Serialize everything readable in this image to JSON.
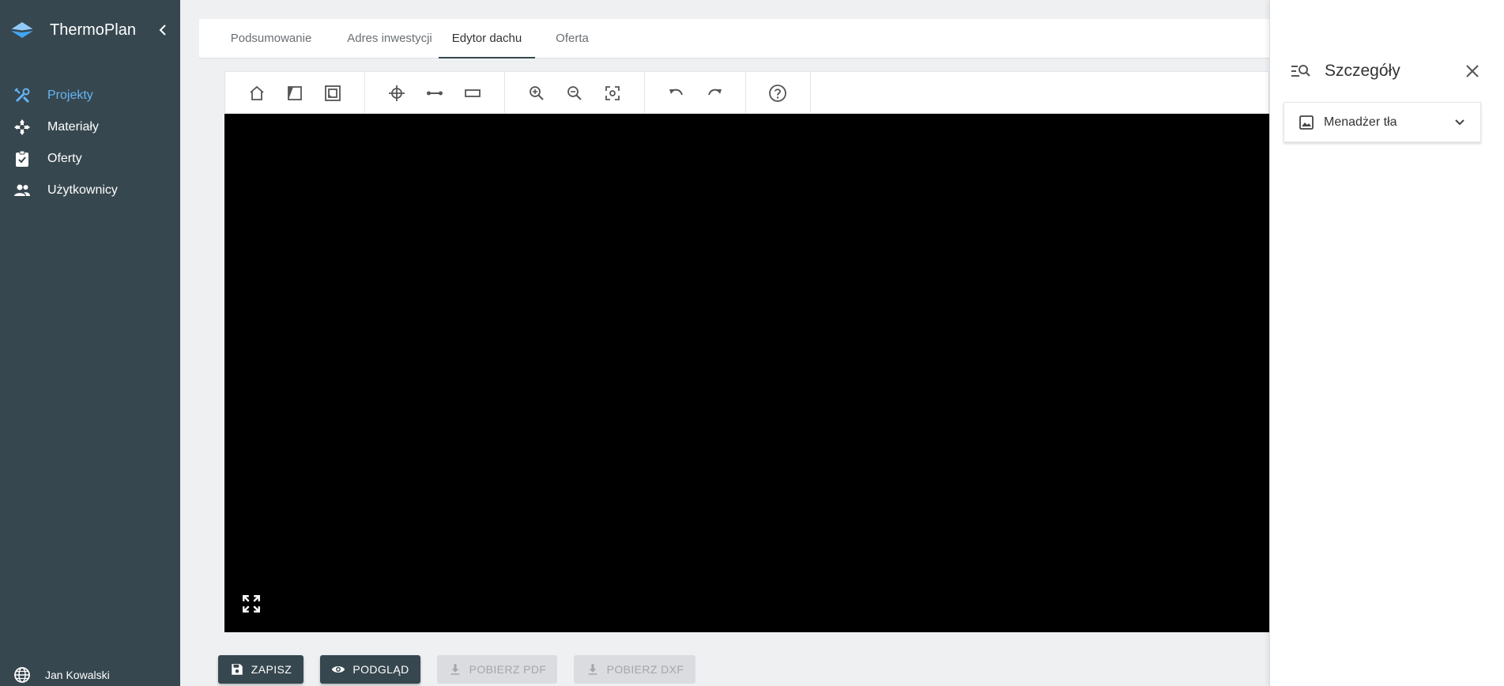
{
  "app": {
    "title": "ThermoPlan"
  },
  "sidebar": {
    "items": [
      {
        "label": "Projekty",
        "icon": "tools-icon",
        "active": true
      },
      {
        "label": "Materiały",
        "icon": "move-icon"
      },
      {
        "label": "Oferty",
        "icon": "clipboard-icon"
      },
      {
        "label": "Użytkownicy",
        "icon": "users-icon"
      }
    ],
    "user": {
      "name": "Jan Kowalski"
    }
  },
  "tabs": [
    {
      "label": "Podsumowanie"
    },
    {
      "label": "Adres inwestycji"
    },
    {
      "label": "Edytor dachu",
      "active": true
    },
    {
      "label": "Oferta"
    }
  ],
  "toolbar": {
    "groups": [
      [
        "home-icon",
        "roof-surface-icon",
        "inner-frame-icon"
      ],
      [
        "crosshair-icon",
        "line-segment-icon",
        "rectangle-icon"
      ],
      [
        "zoom-in-icon",
        "zoom-out-icon",
        "fit-screen-icon"
      ],
      [
        "undo-icon",
        "redo-icon"
      ],
      [
        "help-icon"
      ]
    ]
  },
  "actions": {
    "save": "ZAPISZ",
    "preview": "PODGLĄD",
    "download_pdf": "POBIERZ PDF",
    "download_dxf": "POBIERZ DXF"
  },
  "details_panel": {
    "title": "Szczegóły",
    "accordion_label": "Menadżer tła"
  },
  "colors": {
    "sidebar_bg": "#37474f",
    "active_nav": "#64b5f6",
    "canvas_bg": "#000000"
  }
}
